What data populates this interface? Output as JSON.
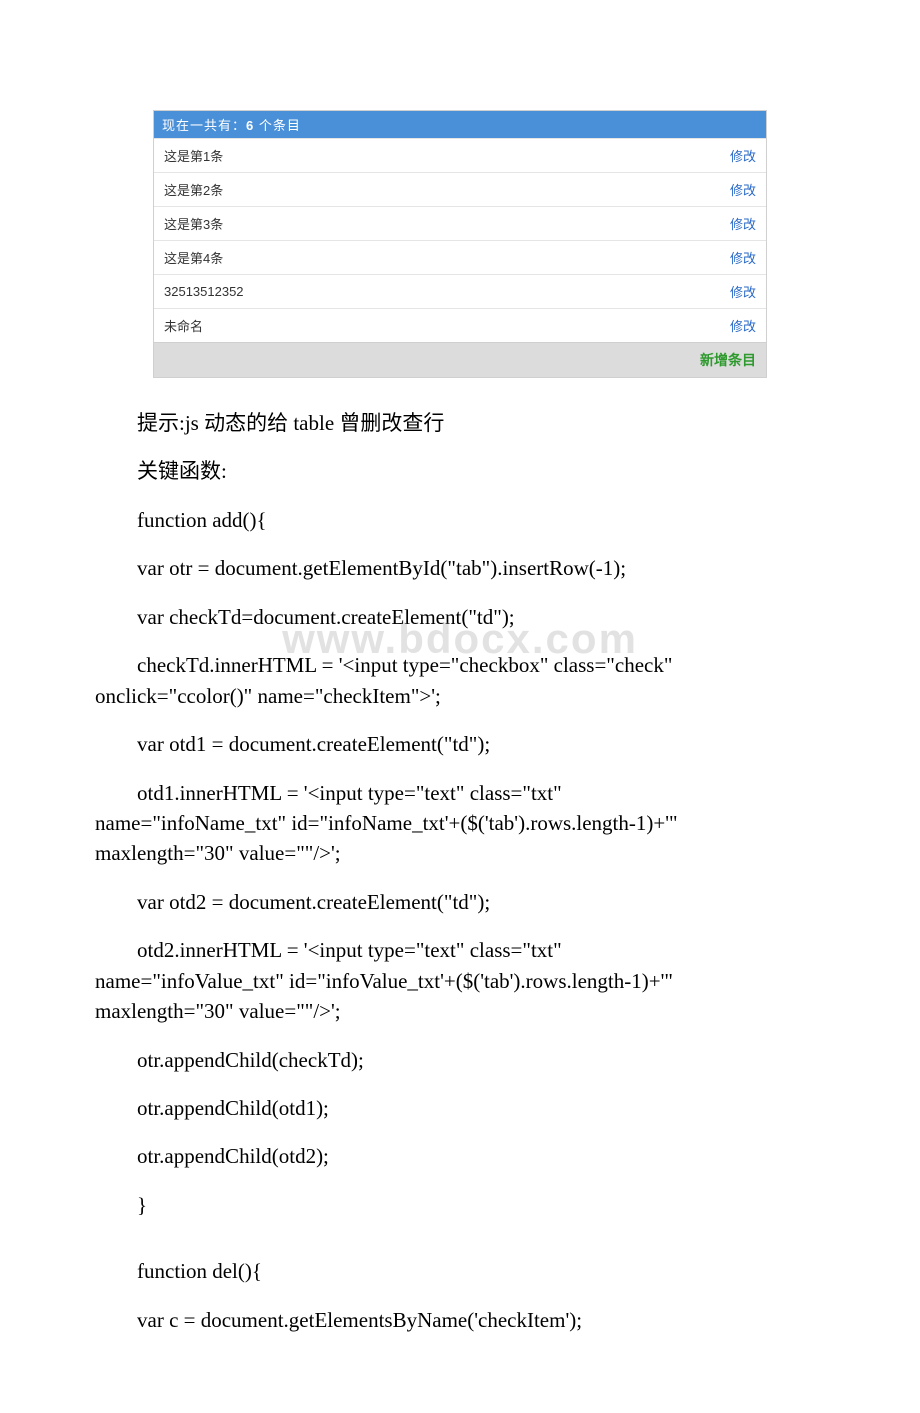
{
  "table": {
    "header_prefix": "现在一共有：",
    "count": "6",
    "header_suffix": " 个条目",
    "rows": [
      {
        "text": "这是第1条",
        "action": "修改"
      },
      {
        "text": "这是第2条",
        "action": "修改"
      },
      {
        "text": "这是第3条",
        "action": "修改"
      },
      {
        "text": "这是第4条",
        "action": "修改"
      },
      {
        "text": "32513512352",
        "action": "修改"
      },
      {
        "text": "未命名",
        "action": "修改"
      }
    ],
    "footer": "新增条目"
  },
  "paragraphs": {
    "p1": "提示:js 动态的给 table 曾删改查行",
    "p2": "关键函数:",
    "p3": " function add(){",
    "p4": "  var otr = document.getElementById(\"tab\").insertRow(-1);",
    "p5": " var checkTd=document.createElement(\"td\");",
    "p6a": " checkTd.innerHTML = '<input type=\"checkbox\" class=\"check\" ",
    "p6b": "onclick=\"ccolor()\" name=\"checkItem\">';",
    "p7": " var otd1 = document.createElement(\"td\");",
    "p8a": " otd1.innerHTML = '<input type=\"text\" class=\"txt\" ",
    "p8b": "name=\"infoName_txt\" id=\"infoName_txt'+($('tab').rows.length-1)+'\" ",
    "p8c": "maxlength=\"30\" value=\"\"/>';",
    "p9": " var otd2 = document.createElement(\"td\");",
    "p10a": " otd2.innerHTML = '<input type=\"text\" class=\"txt\" ",
    "p10b": "name=\"infoValue_txt\" id=\"infoValue_txt'+($('tab').rows.length-1)+'\" ",
    "p10c": "maxlength=\"30\" value=\"\"/>';",
    "p11": "  otr.appendChild(checkTd);",
    "p12": " otr.appendChild(otd1);",
    "p13": " otr.appendChild(otd2);",
    "p14": " }",
    "p15": " function del(){",
    "p16": "  var c = document.getElementsByName('checkItem');"
  },
  "watermark": "www.bdocx.com"
}
